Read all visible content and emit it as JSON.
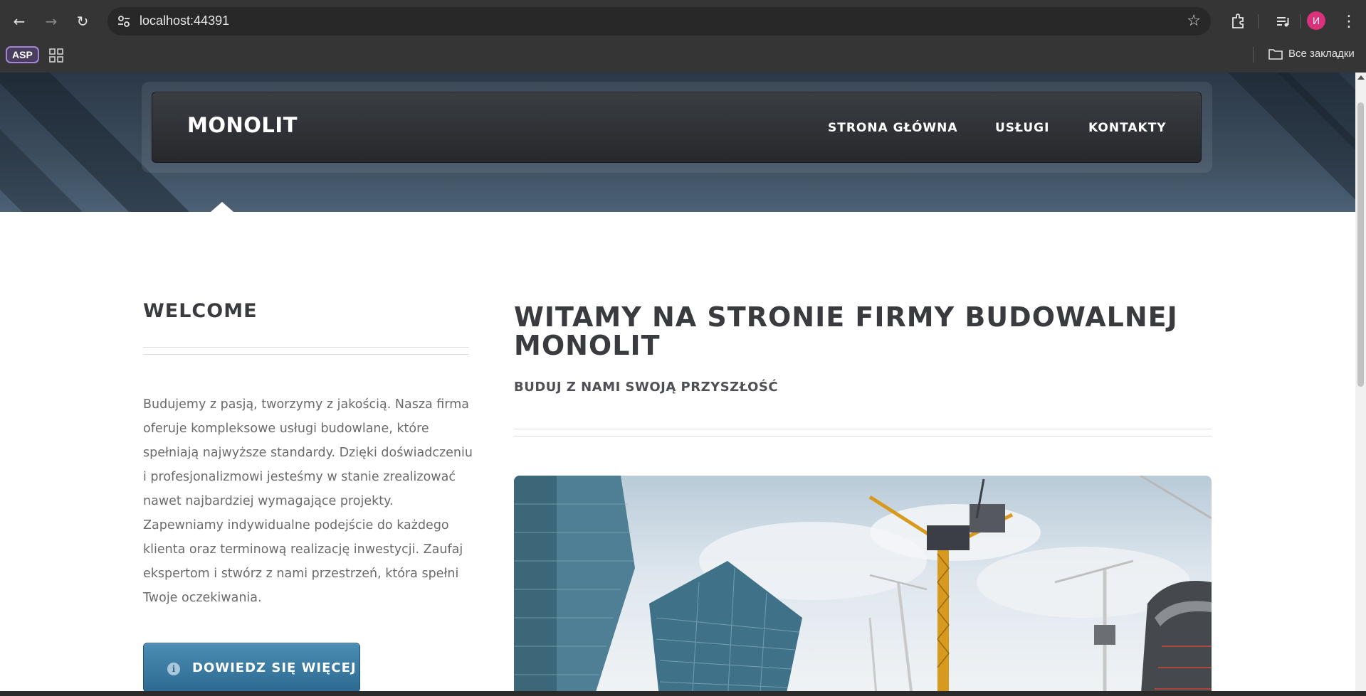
{
  "browser": {
    "url": "localhost:44391",
    "bookmarks": {
      "asp_label": "ASP",
      "all_bookmarks_label": "Все закладки"
    },
    "profile_initial": "И"
  },
  "site": {
    "logo": "MONOLIT",
    "nav": [
      "STRONA GŁÓWNA",
      "USŁUGI",
      "KONTAKTY"
    ]
  },
  "sidebar": {
    "title": "WELCOME",
    "text": "Budujemy z pasją, tworzymy z jakością. Nasza firma oferuje kompleksowe usługi budowlane, które spełniają najwyższe standardy. Dzięki doświadczeniu i profesjonalizmowi jesteśmy w stanie zrealizować nawet najbardziej wymagające projekty. Zapewniamy indywidualne podejście do każdego klienta oraz terminową realizację inwestycji. Zaufaj ekspertom i stwórz z nami przestrzeń, która spełni Twoje oczekiwania.",
    "button": "DOWIEDZ SIĘ WIĘCEJ"
  },
  "main": {
    "title": "WITAMY NA STRONIE FIRMY BUDOWALNEJ MONOLIT",
    "subtitle": "BUDUJ Z NAMI SWOJĄ PRZYSZŁOŚĆ"
  },
  "colors": {
    "nav_bar": "#2c2e32",
    "accent_button": "#3a7ba3",
    "heading": "#3a3b3f",
    "body_text": "#6b6b6b"
  }
}
